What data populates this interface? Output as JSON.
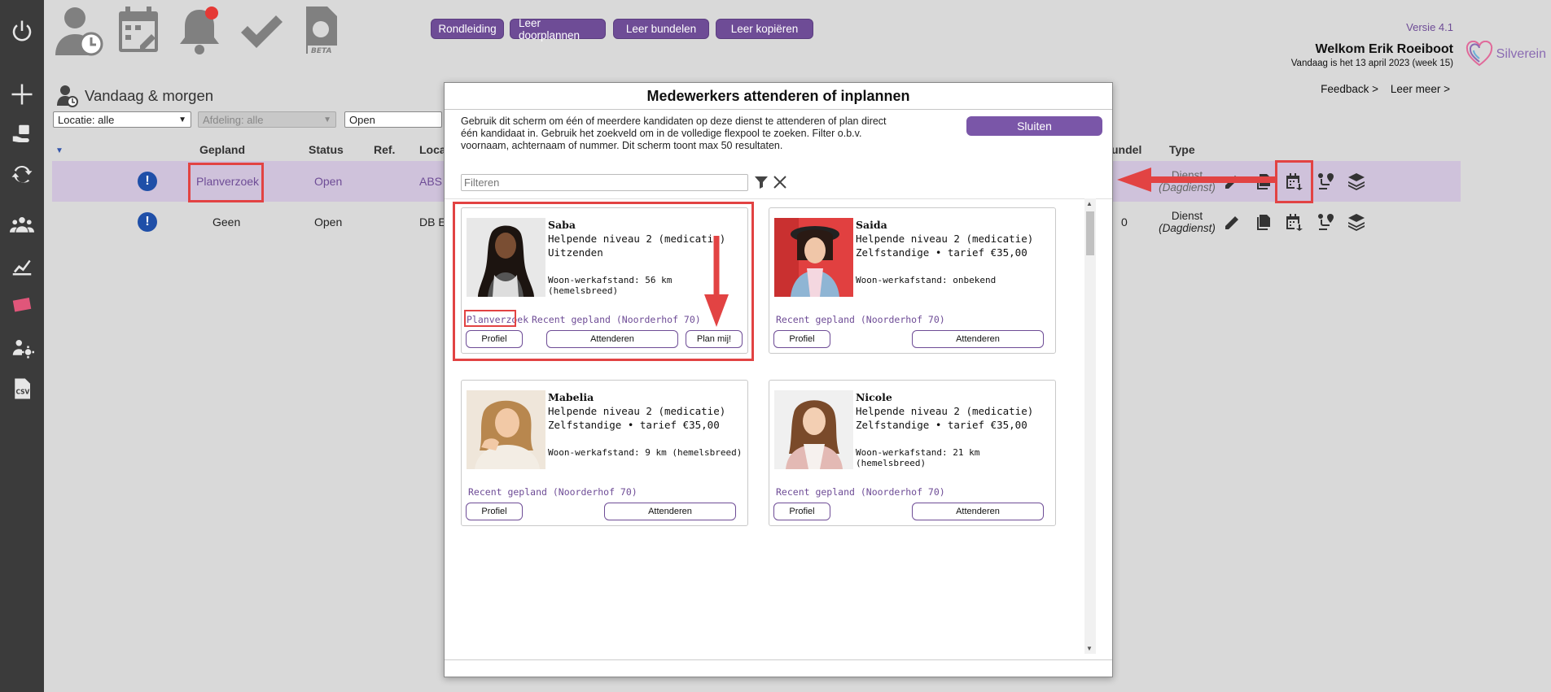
{
  "pills": [
    "Rondleiding",
    "Leer doorplannen",
    "Leer bundelen",
    "Leer kopiëren"
  ],
  "header": {
    "versie": "Versie 4.1",
    "welkom": "Welkom Erik Roeiboot",
    "date": "Vandaag is het 13 april 2023 (week 15)",
    "brand": "Silverein",
    "feedback": "Feedback >",
    "leer_meer": "Leer meer >"
  },
  "section_title": "Vandaag & morgen",
  "filters": {
    "locatie": "Locatie: alle",
    "afdeling": "Afdeling: alle",
    "status": "Open"
  },
  "table": {
    "headers": {
      "gepland": "Gepland",
      "status": "Status",
      "ref": "Ref.",
      "locatie": "Loca",
      "bundel": "undel",
      "type": "Type"
    },
    "rows": [
      {
        "gepland": "Planverzoek",
        "status": "Open",
        "locatie": "ABS",
        "bundel": "",
        "type_line1": "Dienst",
        "type_line2": "(Dagdienst)"
      },
      {
        "gepland": "Geen",
        "status": "Open",
        "locatie": "DB E",
        "bundel": "0",
        "type_line1": "Dienst",
        "type_line2": "(Dagdienst)"
      }
    ]
  },
  "modal": {
    "title": "Medewerkers attenderen of inplannen",
    "description": "Gebruik dit scherm om één of meerdere kandidaten op deze dienst te attenderen of plan direct één kandidaat in. Gebruik het zoekveld om in de volledige flexpool te zoeken. Filter o.b.v. voornaam, achternaam of nummer. Dit scherm toont max 50 resultaten.",
    "close_label": "Sluiten",
    "filter_placeholder": "Filteren",
    "cards": [
      {
        "name": "Saba",
        "role": "Helpende niveau 2 (medicatie)",
        "contract": "Uitzenden",
        "distance": "Woon-werkafstand: 56 km (hemelsbreed)",
        "planverzoek": "Planverzoek",
        "recent": "Recent gepland (Noorderhof 70)",
        "profile": "Profiel",
        "attend": "Attenderen",
        "plan": "Plan mij!"
      },
      {
        "name": "Saida",
        "role": "Helpende niveau 2 (medicatie)",
        "contract": "Zelfstandige • tarief €35,00",
        "distance": "Woon-werkafstand: onbekend",
        "recent": "Recent gepland (Noorderhof 70)",
        "profile": "Profiel",
        "attend": "Attenderen"
      },
      {
        "name": "Mabelia",
        "role": "Helpende niveau 2 (medicatie)",
        "contract": "Zelfstandige • tarief €35,00",
        "distance": "Woon-werkafstand: 9 km (hemelsbreed)",
        "recent": "Recent gepland (Noorderhof 70)",
        "profile": "Profiel",
        "attend": "Attenderen"
      },
      {
        "name": "Nicole",
        "role": "Helpende niveau 2 (medicatie)",
        "contract": "Zelfstandige • tarief €35,00",
        "distance": "Woon-werkafstand: 21 km (hemelsbreed)",
        "recent": "Recent gepland (Noorderhof 70)",
        "profile": "Profiel",
        "attend": "Attenderen"
      }
    ]
  },
  "colors": {
    "accent": "#6e4c96",
    "sidebar": "#3b3b3b",
    "highlight": "#e24343"
  }
}
